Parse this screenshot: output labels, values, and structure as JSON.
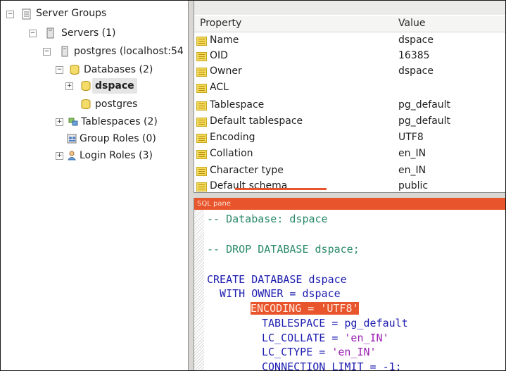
{
  "tree": {
    "server_groups": "Server Groups",
    "servers": "Servers (1)",
    "server": "postgres (localhost:54",
    "databases": "Databases (2)",
    "db_selected": "dspace",
    "db_other": "postgres",
    "tablespaces": "Tablespaces (2)",
    "group_roles": "Group Roles (0)",
    "login_roles": "Login Roles (3)",
    "expand_plus": "+",
    "expand_minus": "−"
  },
  "properties": {
    "header_property": "Property",
    "header_value": "Value",
    "rows": [
      {
        "name": "Name",
        "value": "dspace"
      },
      {
        "name": "OID",
        "value": "16385"
      },
      {
        "name": "Owner",
        "value": "dspace"
      },
      {
        "name": "ACL",
        "value": ""
      },
      {
        "name": "Tablespace",
        "value": "pg_default"
      },
      {
        "name": "Default tablespace",
        "value": "pg_default"
      },
      {
        "name": "Encoding",
        "value": "UTF8"
      },
      {
        "name": "Collation",
        "value": "en_IN"
      },
      {
        "name": "Character type",
        "value": "en_IN"
      },
      {
        "name": "Default schema",
        "value": "public"
      }
    ]
  },
  "sql": {
    "title": "SQL pane",
    "line1": "-- Database: dspace",
    "line2": "-- DROP DATABASE dspace;",
    "line3": "CREATE DATABASE dspace",
    "line4": "  WITH OWNER = dspace",
    "line5": "ENCODING = 'UTF8'",
    "line6_a": "TABLESPACE = pg_default",
    "line7_a": "LC_COLLATE = ",
    "line7_b": "'en_IN'",
    "line8_a": "LC_CTYPE = ",
    "line8_b": "'en_IN'",
    "line9": "CONNECTION LIMIT = -1;"
  },
  "colors": {
    "accent": "#e8552c",
    "keyword": "#1c1cb0",
    "comment": "#2a8a6a",
    "string": "#9a1fb3"
  }
}
